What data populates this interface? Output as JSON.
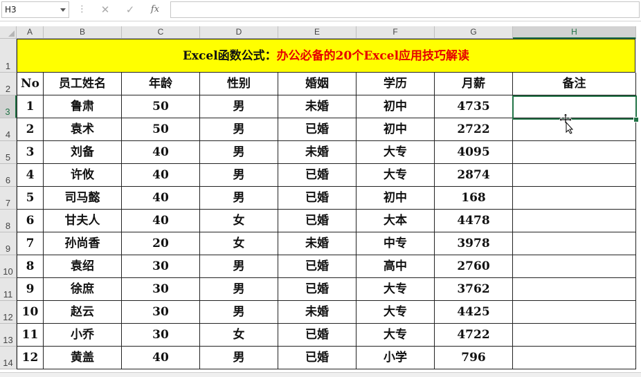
{
  "formula_bar": {
    "name_box": "H3",
    "cancel_icon": "✕",
    "enter_icon": "✓",
    "fx_label": "fx",
    "formula": ""
  },
  "columns": [
    "A",
    "B",
    "C",
    "D",
    "E",
    "F",
    "G",
    "H"
  ],
  "rows": [
    "1",
    "2",
    "3",
    "4",
    "5",
    "6",
    "7",
    "8",
    "9",
    "10",
    "11",
    "12",
    "13",
    "14"
  ],
  "title": {
    "part1": "Excel函数公式：",
    "part2": "办公必备的20个Excel应用技巧解读"
  },
  "headers": [
    "No",
    "员工姓名",
    "年龄",
    "性别",
    "婚姻",
    "学历",
    "月薪",
    "备注"
  ],
  "table": [
    [
      "1",
      "鲁肃",
      "50",
      "男",
      "未婚",
      "初中",
      "4735",
      ""
    ],
    [
      "2",
      "袁术",
      "50",
      "男",
      "已婚",
      "初中",
      "2722",
      ""
    ],
    [
      "3",
      "刘备",
      "40",
      "男",
      "未婚",
      "大专",
      "4095",
      ""
    ],
    [
      "4",
      "许攸",
      "40",
      "男",
      "已婚",
      "大专",
      "2874",
      ""
    ],
    [
      "5",
      "司马懿",
      "40",
      "男",
      "已婚",
      "初中",
      "168",
      ""
    ],
    [
      "6",
      "甘夫人",
      "40",
      "女",
      "已婚",
      "大本",
      "4478",
      ""
    ],
    [
      "7",
      "孙尚香",
      "20",
      "女",
      "未婚",
      "中专",
      "3978",
      ""
    ],
    [
      "8",
      "袁绍",
      "30",
      "男",
      "已婚",
      "高中",
      "2760",
      ""
    ],
    [
      "9",
      "徐庶",
      "30",
      "男",
      "已婚",
      "大专",
      "3762",
      ""
    ],
    [
      "10",
      "赵云",
      "30",
      "男",
      "未婚",
      "大专",
      "4425",
      ""
    ],
    [
      "11",
      "小乔",
      "30",
      "女",
      "已婚",
      "大专",
      "4722",
      ""
    ],
    [
      "12",
      "黄盖",
      "40",
      "男",
      "已婚",
      "小学",
      "796",
      ""
    ]
  ],
  "selection": {
    "cell": "H3",
    "accent_color": "#217346"
  }
}
